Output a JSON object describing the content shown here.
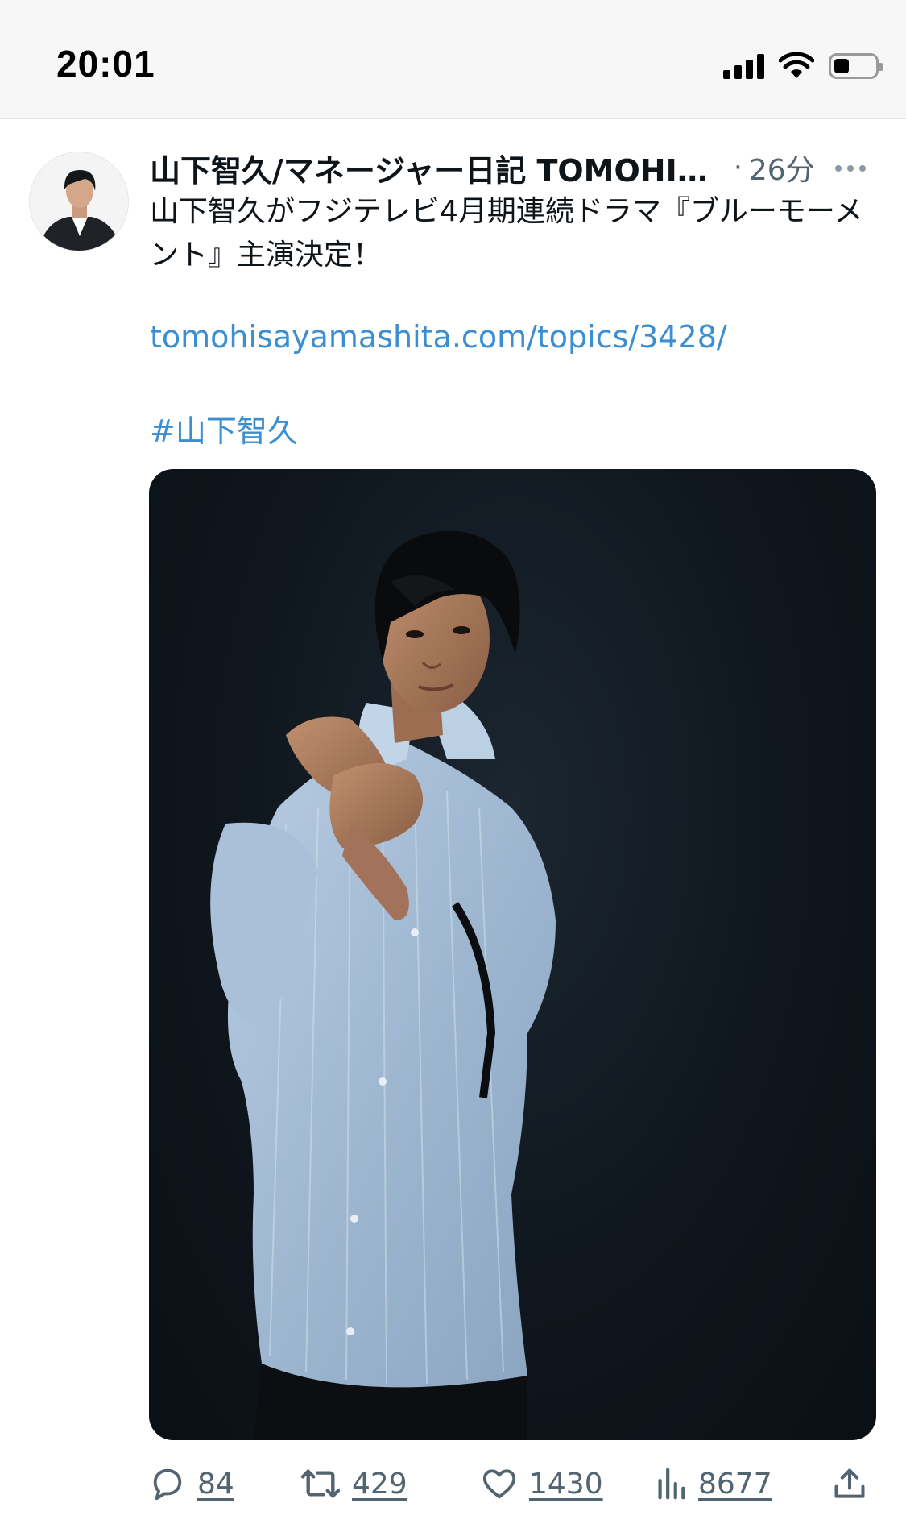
{
  "status_bar": {
    "time": "20:01",
    "icons": [
      "signal-icon",
      "wifi-icon",
      "battery-icon"
    ],
    "battery_level": 0.35
  },
  "tweet": {
    "author_name": "山下智久/マネージャー日記 TOMOHISA YAMASHITA STAFF",
    "time_separator": "·",
    "time_ago": "26分",
    "text_line": "山下智久がフジテレビ4月期連続ドラマ『ブルーモーメント』主演決定！",
    "link": "tomohisayamashita.com/topics/3428/",
    "hashtag": "#山下智久",
    "media": {
      "alt": "photo"
    }
  },
  "actions": {
    "replies": "84",
    "retweets": "429",
    "likes": "1430",
    "views": "8677",
    "icons": [
      "reply-icon",
      "retweet-icon",
      "like-icon",
      "views-icon",
      "share-icon"
    ]
  },
  "colors": {
    "link": "#3b8fd1",
    "secondary_text": "#536471",
    "status_bar_bg": "#f7f7f8"
  }
}
